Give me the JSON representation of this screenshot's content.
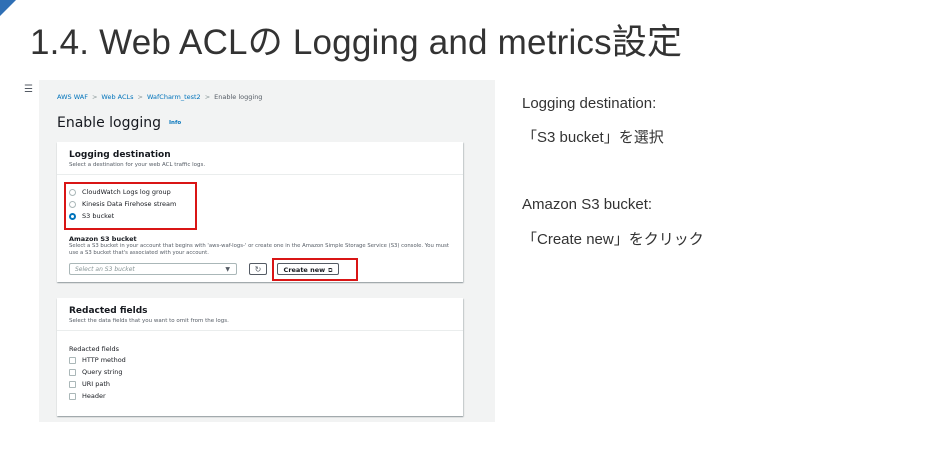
{
  "slide": {
    "title": "1.4. Web ACLの Logging and metrics設定"
  },
  "menu_icon": "☰",
  "breadcrumb": {
    "items": [
      "AWS WAF",
      "Web ACLs",
      "WafCharm_test2"
    ],
    "current": "Enable logging",
    "separator": ">"
  },
  "page": {
    "heading": "Enable logging",
    "info_label": "Info"
  },
  "logging_destination": {
    "title": "Logging destination",
    "description": "Select a destination for your web ACL traffic logs.",
    "options": [
      {
        "label": "CloudWatch Logs log group",
        "selected": false
      },
      {
        "label": "Kinesis Data Firehose stream",
        "selected": false
      },
      {
        "label": "S3 bucket",
        "selected": true
      }
    ],
    "s3": {
      "label": "Amazon S3 bucket",
      "description": "Select a S3 bucket in your account that begins with 'aws-waf-logs-' or create one in the Amazon Simple Storage Service (S3) console. You must use a S3 bucket that's associated with your account.",
      "select_placeholder": "Select an S3 bucket",
      "refresh_icon": "refresh-icon",
      "create_button": "Create new",
      "external_icon": "external-link-icon"
    }
  },
  "redacted": {
    "title": "Redacted fields",
    "description": "Select the data fields that you want to omit from the logs.",
    "group_label": "Redacted fields",
    "options": [
      "HTTP method",
      "Query string",
      "URI path",
      "Header"
    ]
  },
  "notes": {
    "line1": "Logging destination:",
    "line2": "「S3 bucket」を選択",
    "line3": "Amazon S3 bucket:",
    "line4": "「Create new」をクリック"
  },
  "colors": {
    "accent": "#0073bb",
    "highlight": "#d91515",
    "corner": "#2f6fb5"
  }
}
